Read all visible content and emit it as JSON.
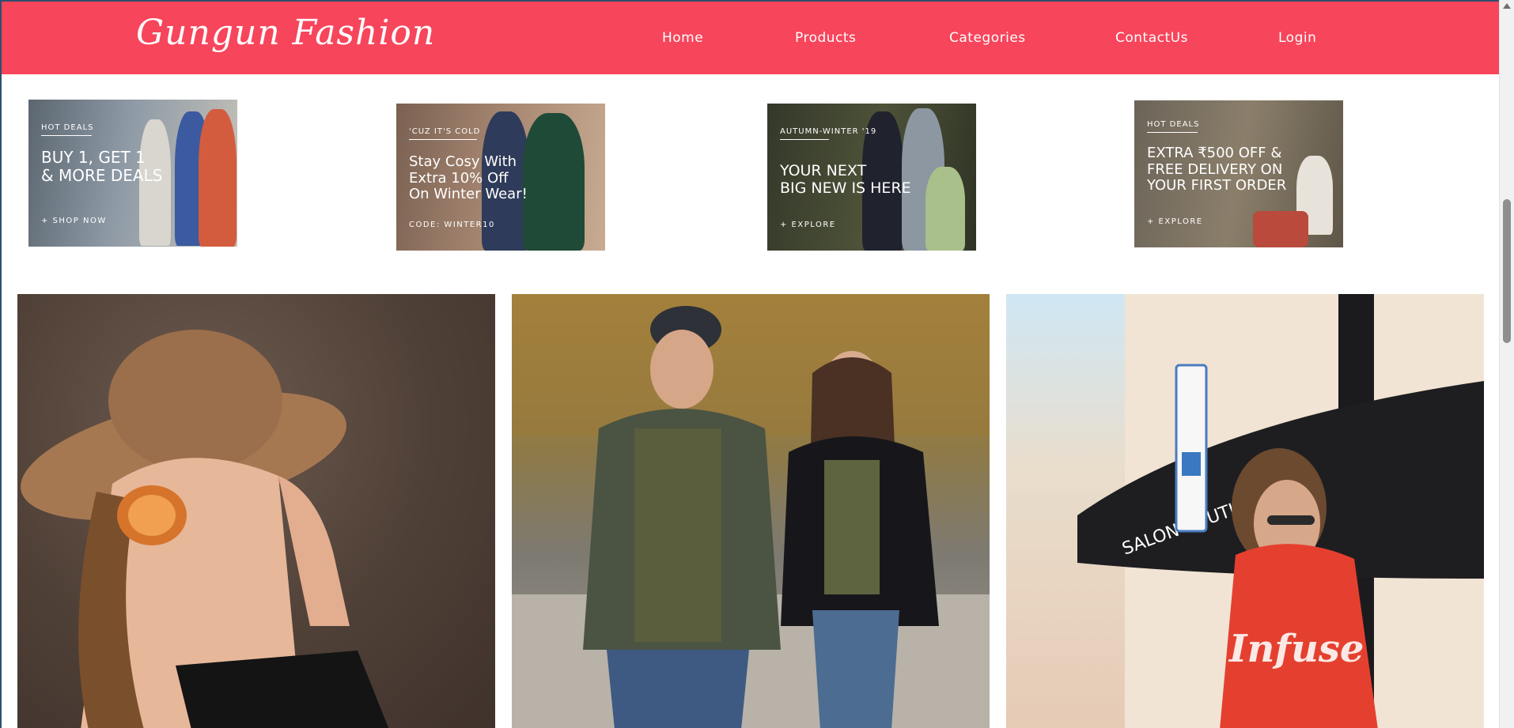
{
  "brand": {
    "name": "Gungun Fashion",
    "color": "#f7455b"
  },
  "nav": {
    "home": "Home",
    "products": "Products",
    "categories": "Categories",
    "contact": "ContactUs",
    "login": "Login"
  },
  "promos": [
    {
      "overline": "HOT DEALS",
      "headline": "BUY 1, GET 1\n& MORE DEALS",
      "cta": "+ SHOP NOW"
    },
    {
      "overline": "'CUZ IT'S COLD",
      "headline": "Stay Cosy With\nExtra 10% Off\nOn Winter Wear!",
      "cta": "CODE: WINTER10"
    },
    {
      "overline": "AUTUMN-WINTER '19",
      "headline": "YOUR NEXT\nBIG NEW IS HERE",
      "cta": "+ EXPLORE"
    },
    {
      "overline": "HOT DEALS",
      "headline": "EXTRA ₹500 OFF &\nFREE DELIVERY ON\nYOUR FIRST ORDER",
      "cta": "+ EXPLORE"
    }
  ],
  "photos": {
    "shirt_print": "Infuse",
    "awning_text": "SALON BOUTIQUE"
  },
  "icons": {
    "scroll_up": "arrow-up-icon"
  }
}
